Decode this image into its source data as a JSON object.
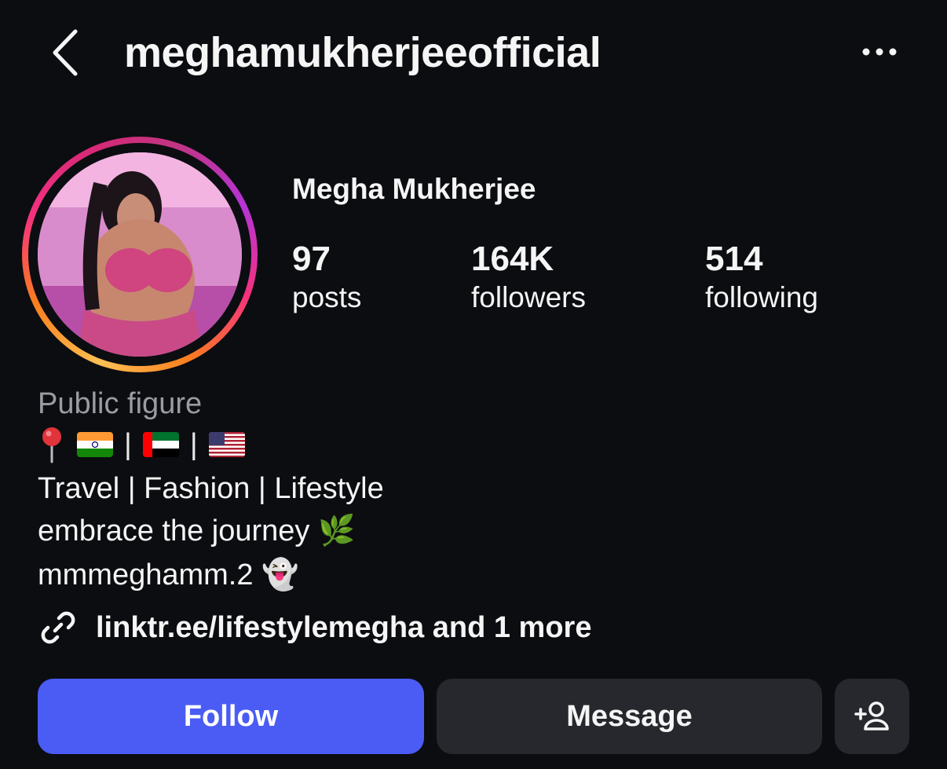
{
  "header": {
    "username": "meghamukherjeeofficial",
    "back_icon": "chevron-left-icon",
    "more_icon": "more-horizontal-icon"
  },
  "profile": {
    "display_name": "Megha Mukherjee",
    "stats": [
      {
        "value": "97",
        "label": "posts"
      },
      {
        "value": "164K",
        "label": "followers"
      },
      {
        "value": "514",
        "label": "following"
      }
    ],
    "story_ring_colors": [
      "#fec053",
      "#fa7e1e",
      "#f5317f",
      "#c13584"
    ]
  },
  "bio": {
    "category": "Public figure",
    "flags_line": {
      "icons": [
        "pin-icon",
        "india-flag-icon",
        "uae-flag-icon",
        "usa-flag-icon"
      ],
      "separator": "|"
    },
    "line1": "Travel | Fashion | Lifestyle",
    "line2": "embrace the journey 🌿",
    "line3": "mmmeghamm.2 👻",
    "link": {
      "icon": "link-icon",
      "text": "linktr.ee/lifestylemegha and 1 more"
    }
  },
  "actions": {
    "follow_label": "Follow",
    "message_label": "Message",
    "add_user_icon": "add-person-icon",
    "follow_color": "#4a5cf4",
    "secondary_color": "#26282d"
  }
}
